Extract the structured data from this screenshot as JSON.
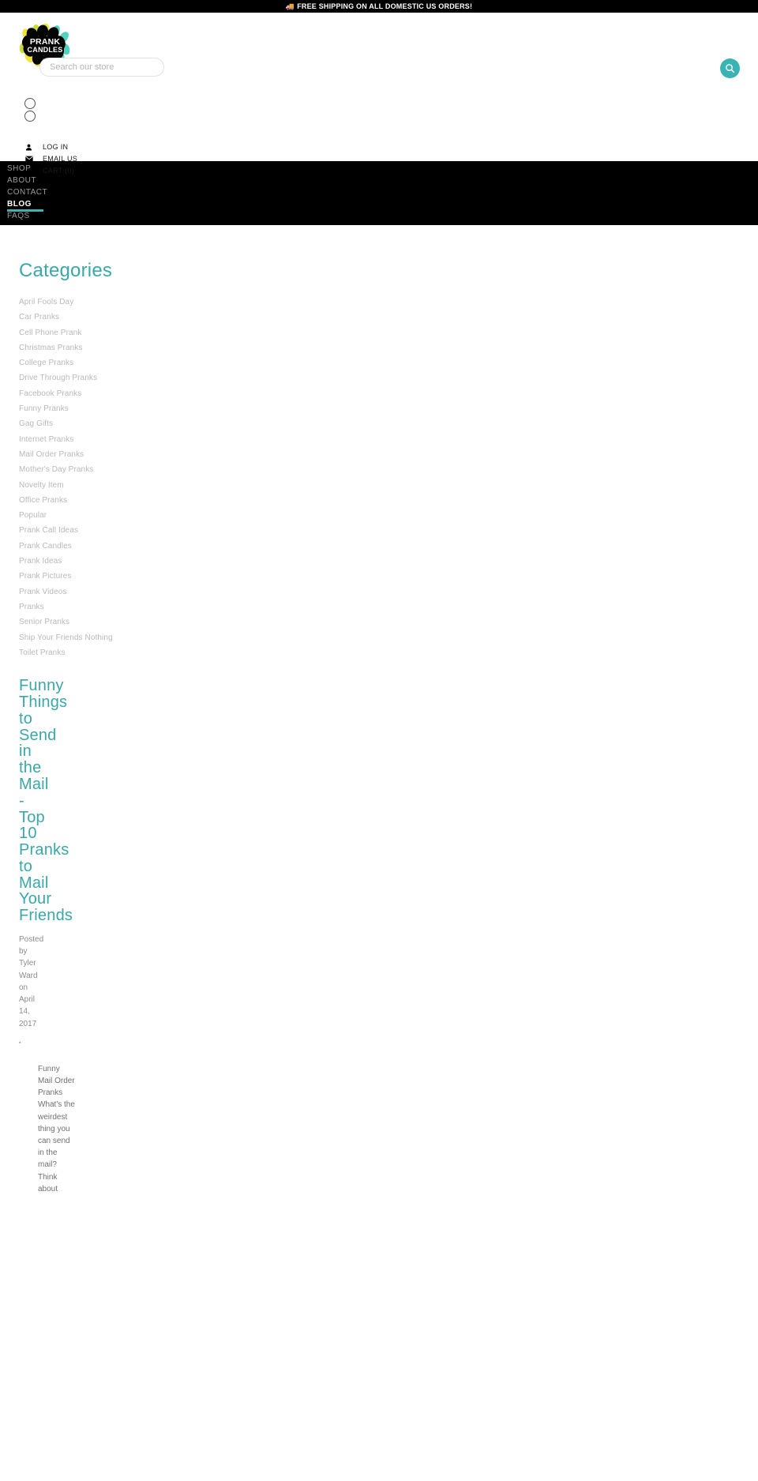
{
  "announcement": {
    "icon": "truck-icon",
    "text": "FREE SHIPPING ON ALL DOMESTIC US ORDERS!"
  },
  "brand": {
    "logo_line1": "PRANK",
    "logo_line2": "CANDLES",
    "logo_alt": "prank-candles-logo"
  },
  "search": {
    "placeholder": "Search our store",
    "value": "",
    "button_icon": "search-icon"
  },
  "social": {
    "items": [
      {
        "name": "social-circle-1"
      },
      {
        "name": "social-circle-2"
      }
    ]
  },
  "utility": {
    "items": [
      {
        "icon": "user-icon",
        "label": "LOG IN"
      },
      {
        "icon": "envelope-icon",
        "label": "EMAIL US"
      },
      {
        "icon": "cart-icon",
        "label": "CART (0)"
      }
    ]
  },
  "nav": {
    "items": [
      {
        "label": "SHOP",
        "active": false
      },
      {
        "label": "ABOUT",
        "active": false
      },
      {
        "label": "CONTACT",
        "active": false
      },
      {
        "label": "BLOG",
        "active": true
      },
      {
        "label": "FAQS",
        "active": false
      }
    ]
  },
  "sidebar": {
    "heading": "Categories",
    "items": [
      {
        "label": "April Fools Day"
      },
      {
        "label": "Car Pranks"
      },
      {
        "label": "Cell Phone Prank"
      },
      {
        "label": "Christmas Pranks"
      },
      {
        "label": "College Pranks"
      },
      {
        "label": "Drive Through Pranks"
      },
      {
        "label": "Facebook Pranks"
      },
      {
        "label": "Funny Pranks"
      },
      {
        "label": "Gag Gifts"
      },
      {
        "label": "Internet Pranks"
      },
      {
        "label": "Mail Order Pranks"
      },
      {
        "label": "Mother's Day Pranks"
      },
      {
        "label": "Novelty Item"
      },
      {
        "label": "Office Pranks"
      },
      {
        "label": "Popular"
      },
      {
        "label": "Prank Call Ideas"
      },
      {
        "label": "Prank Candles"
      },
      {
        "label": "Prank Ideas"
      },
      {
        "label": "Prank Pictures"
      },
      {
        "label": "Prank Videos"
      },
      {
        "label": "Pranks"
      },
      {
        "label": "Senior Pranks"
      },
      {
        "label": "Ship Your Friends Nothing"
      },
      {
        "label": "Toilet Pranks"
      }
    ]
  },
  "article": {
    "title": "Funny Things to Send in the Mail - Top 10 Pranks to Mail Your Friends",
    "meta": "Posted by Tyler Ward on April 14, 2017",
    "broken_image_alt": "broken-image-placeholder",
    "body": "Funny Mail Order Pranks What's the weirdest thing you can send in the mail? Think about"
  },
  "colors": {
    "accent_teal": "#3cb3b3",
    "nav_background": "#000000",
    "muted_text": "#b9b9b9",
    "body_text": "#707070"
  }
}
